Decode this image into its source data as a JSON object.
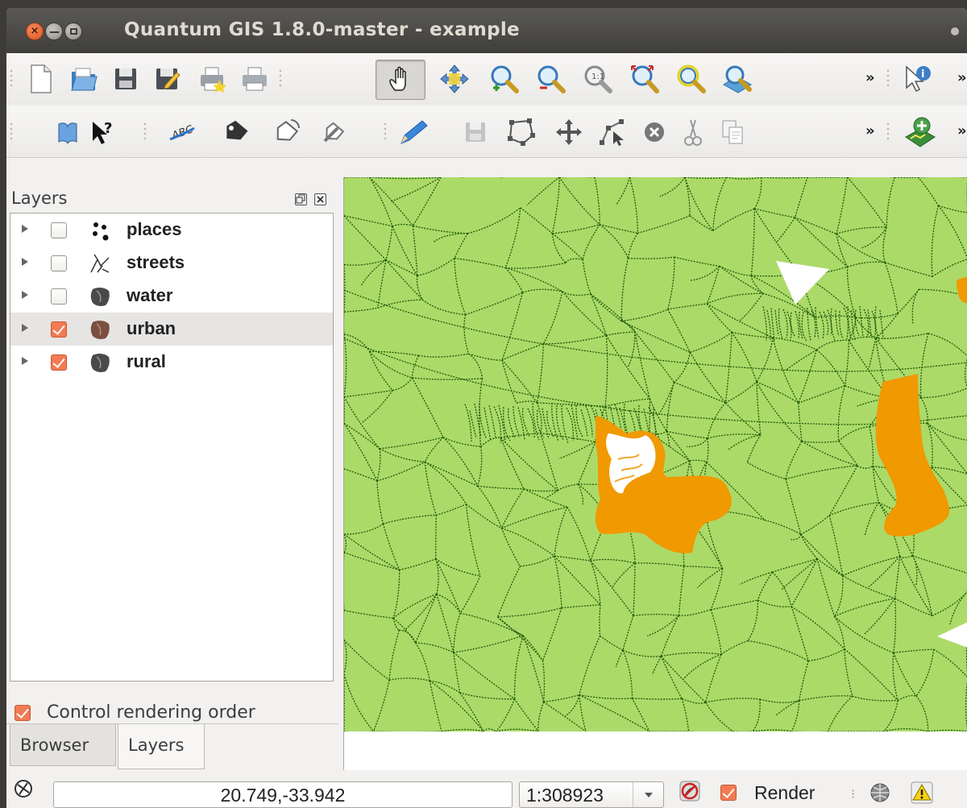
{
  "window": {
    "title": "Quantum GIS 1.8.0-master - example",
    "close_glyph": "×"
  },
  "toolbar1": {
    "buttons": [
      "new-project-icon",
      "open-project-icon",
      "save-project-icon",
      "save-as-icon",
      "print-composer-icon",
      "composer-manager-icon",
      "pan-icon",
      "pan-to-selection-icon",
      "zoom-in-icon",
      "zoom-out-icon",
      "zoom-native-icon",
      "zoom-full-icon",
      "zoom-to-selection-icon",
      "zoom-to-layer-icon"
    ],
    "active": "pan-icon",
    "more": "»",
    "trailing": [
      "identify-icon"
    ]
  },
  "toolbar2": {
    "buttons": [
      "open-table-icon",
      "whats-this-icon",
      "label-icon",
      "move-label-icon",
      "rotate-label-icon",
      "label-properties-icon",
      "toggle-editing-icon",
      "save-edits-icon",
      "add-feature-icon",
      "move-feature-icon",
      "node-tool-icon",
      "delete-selected-icon",
      "cut-features-icon",
      "copy-features-icon"
    ],
    "more": "»",
    "trailing": [
      "plugin-install-icon"
    ]
  },
  "layers_panel": {
    "title": "Layers",
    "layers": [
      {
        "name": "places",
        "checked": false,
        "icon": "point-layer-icon"
      },
      {
        "name": "streets",
        "checked": false,
        "icon": "line-layer-icon"
      },
      {
        "name": "water",
        "checked": false,
        "icon": "polygon-layer-icon"
      },
      {
        "name": "urban",
        "checked": true,
        "icon": "polygon-layer-icon",
        "selected": true
      },
      {
        "name": "rural",
        "checked": true,
        "icon": "polygon-layer-icon"
      }
    ],
    "control_rendering_order": "Control rendering order",
    "control_rendering_order_checked": true
  },
  "tabs": {
    "browser": "Browser",
    "layers": "Layers",
    "active": "Layers"
  },
  "map": {
    "rural_fill": "#acda69",
    "boundary_color": "#1e5a0a",
    "urban_fill": "#f09900"
  },
  "status": {
    "coordinates": "20.749,-33.942",
    "scale": "1:308923",
    "render_label": "Render",
    "render_checked": true
  }
}
